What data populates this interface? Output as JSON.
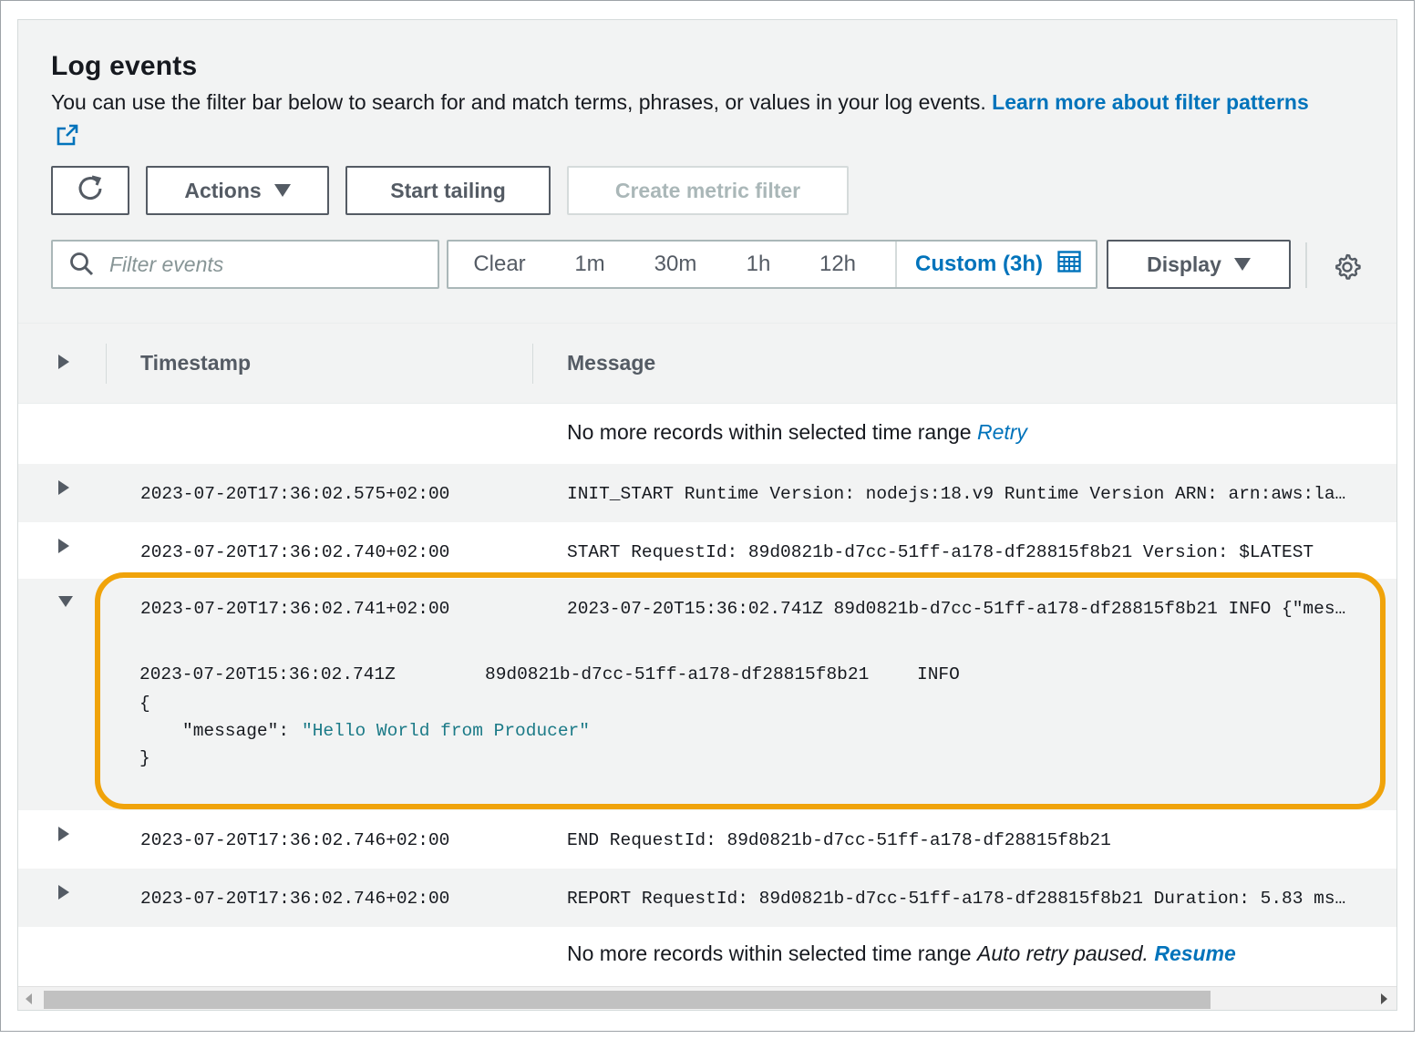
{
  "header": {
    "title": "Log events",
    "description": "You can use the filter bar below to search for and match terms, phrases, or values in your log events.",
    "learn_more_link": "Learn more about filter patterns"
  },
  "toolbar": {
    "refresh_icon": "refresh-icon",
    "actions_label": "Actions",
    "start_tailing_label": "Start tailing",
    "create_metric_filter_label": "Create metric filter"
  },
  "filter": {
    "placeholder": "Filter events",
    "value": ""
  },
  "time_range": {
    "options": [
      "Clear",
      "1m",
      "30m",
      "1h",
      "12h"
    ],
    "selected": "Custom (3h)"
  },
  "display_label": "Display",
  "table": {
    "columns": [
      "Timestamp",
      "Message"
    ],
    "top_note": {
      "text": "No more records within selected time range",
      "link": "Retry"
    },
    "rows": [
      {
        "timestamp": "2023-07-20T17:36:02.575+02:00",
        "message": "INIT_START Runtime Version: nodejs:18.v9 Runtime Version ARN: arn:aws:la…",
        "expanded": false
      },
      {
        "timestamp": "2023-07-20T17:36:02.740+02:00",
        "message": "START RequestId: 89d0821b-d7cc-51ff-a178-df28815f8b21 Version: $LATEST",
        "expanded": false
      },
      {
        "timestamp": "2023-07-20T17:36:02.741+02:00",
        "message": "2023-07-20T15:36:02.741Z 89d0821b-d7cc-51ff-a178-df28815f8b21 INFO {\"mes…",
        "expanded": true
      },
      {
        "timestamp": "2023-07-20T17:36:02.746+02:00",
        "message": "END RequestId: 89d0821b-d7cc-51ff-a178-df28815f8b21",
        "expanded": false
      },
      {
        "timestamp": "2023-07-20T17:36:02.746+02:00",
        "message": "REPORT RequestId: 89d0821b-d7cc-51ff-a178-df28815f8b21 Duration: 5.83 ms…",
        "expanded": false
      }
    ],
    "expanded_detail": {
      "timestamp": "2023-07-20T15:36:02.741Z",
      "request_id": "89d0821b-d7cc-51ff-a178-df28815f8b21",
      "level": "INFO",
      "open_brace": "{",
      "key": "\"message\":",
      "value": "\"Hello World from Producer\"",
      "close_brace": "}"
    },
    "bottom_note": {
      "text": "No more records within selected time range",
      "status": "Auto retry paused.",
      "link": "Resume"
    }
  },
  "colors": {
    "accent": "#0073bb",
    "highlight": "#f0a30a",
    "json_string": "#1b7a87"
  }
}
